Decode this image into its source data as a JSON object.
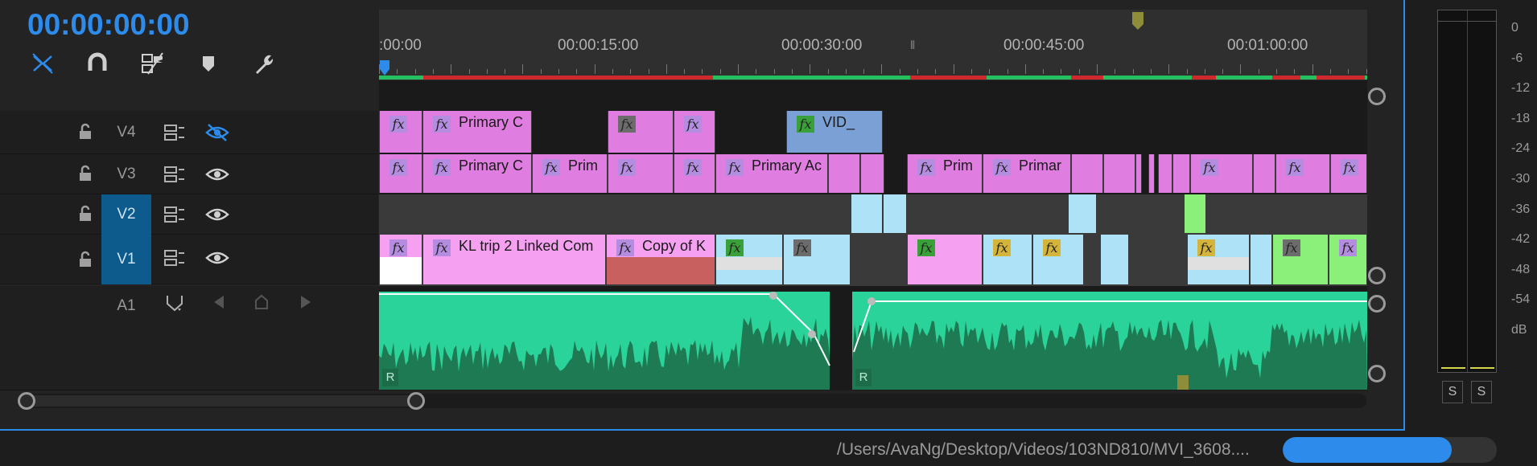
{
  "timecode": "00:00:00:00",
  "toolbar": {
    "icons": [
      "ripple-edit-icon",
      "snap-magnet-icon",
      "linked-selection-icon",
      "marker-icon",
      "wrench-icon"
    ]
  },
  "ruler": {
    "labels": [
      ":00:00",
      "00:00:15:00",
      "00:00:30:00",
      "00:00:45:00",
      "00:01:00:00"
    ]
  },
  "tracks": {
    "v4": "V4",
    "v3": "V3",
    "v2": "V2",
    "v1": "V1",
    "a1": "A1"
  },
  "clips": {
    "v4": [
      "Primary C",
      "VID_"
    ],
    "v3": [
      "Primary C",
      "Prim",
      "Primary Ac",
      "Prim",
      "Primar"
    ],
    "v1": [
      "KL trip 2 Linked Com",
      "Copy of K"
    ]
  },
  "audio_badge": "R",
  "meter": {
    "db_labels": [
      "0",
      "-6",
      "-12",
      "-18",
      "-24",
      "-30",
      "-36",
      "-42",
      "-48",
      "-54",
      "dB"
    ],
    "solo_left": "S",
    "solo_right": "S"
  },
  "status": {
    "path": "/Users/AvaNg/Desktop/Videos/103ND810/MVI_3608....",
    "progress": 0.79
  },
  "colors": {
    "accent": "#2d8ceb",
    "clip_pink": "#e07de0",
    "clip_light_pink": "#f5a0f0",
    "clip_blue": "#7aa0d6",
    "clip_cyan": "#aee2f7",
    "clip_green": "#8af07a",
    "audio": "#2ad39a"
  }
}
